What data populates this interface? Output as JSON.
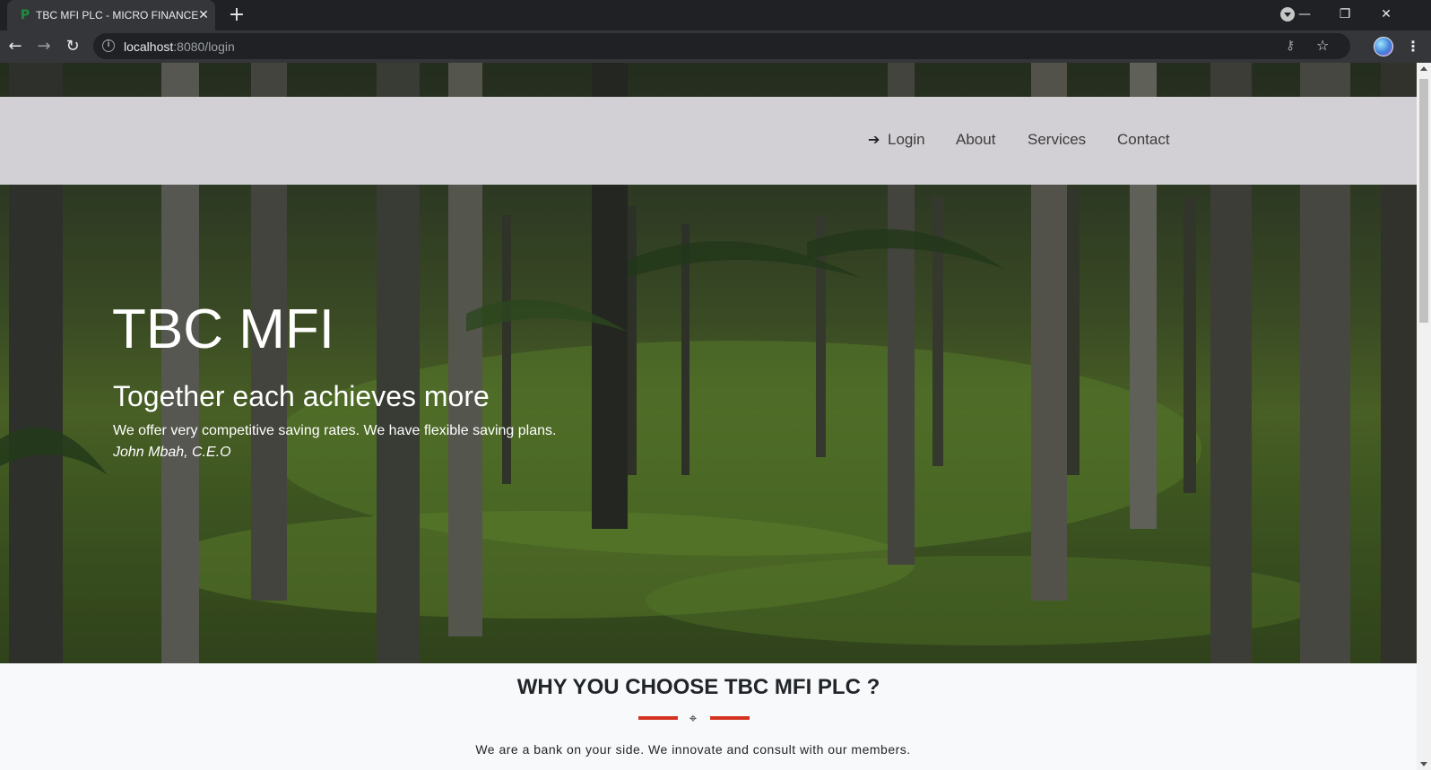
{
  "browser": {
    "tab_title": "TBC MFI PLC - MICRO FINANCE",
    "favicon": "P",
    "url_host": "localhost",
    "url_path": ":8080/login",
    "icons": [
      "tab-close-icon",
      "new-tab-icon",
      "back-icon",
      "forward-icon",
      "reload-icon",
      "info-icon",
      "key-icon",
      "star-icon",
      "menu-icon"
    ]
  },
  "nav": {
    "login": "Login",
    "about": "About",
    "services": "Services",
    "contact": "Contact"
  },
  "hero": {
    "title": "TBC MFI",
    "subtitle": "Together each achieves more",
    "text": "We offer very competitive saving rates. We have flexible saving plans.",
    "author": "John Mbah, C.E.O"
  },
  "why": {
    "title": "WHY YOU CHOOSE TBC MFI PLC ?",
    "text": "We are a bank on your side. We innovate and consult with our members."
  },
  "colors": {
    "navbar_bg": "#d3d0d5",
    "accent": "#d4331f",
    "section_bg": "#f8f9fa"
  }
}
